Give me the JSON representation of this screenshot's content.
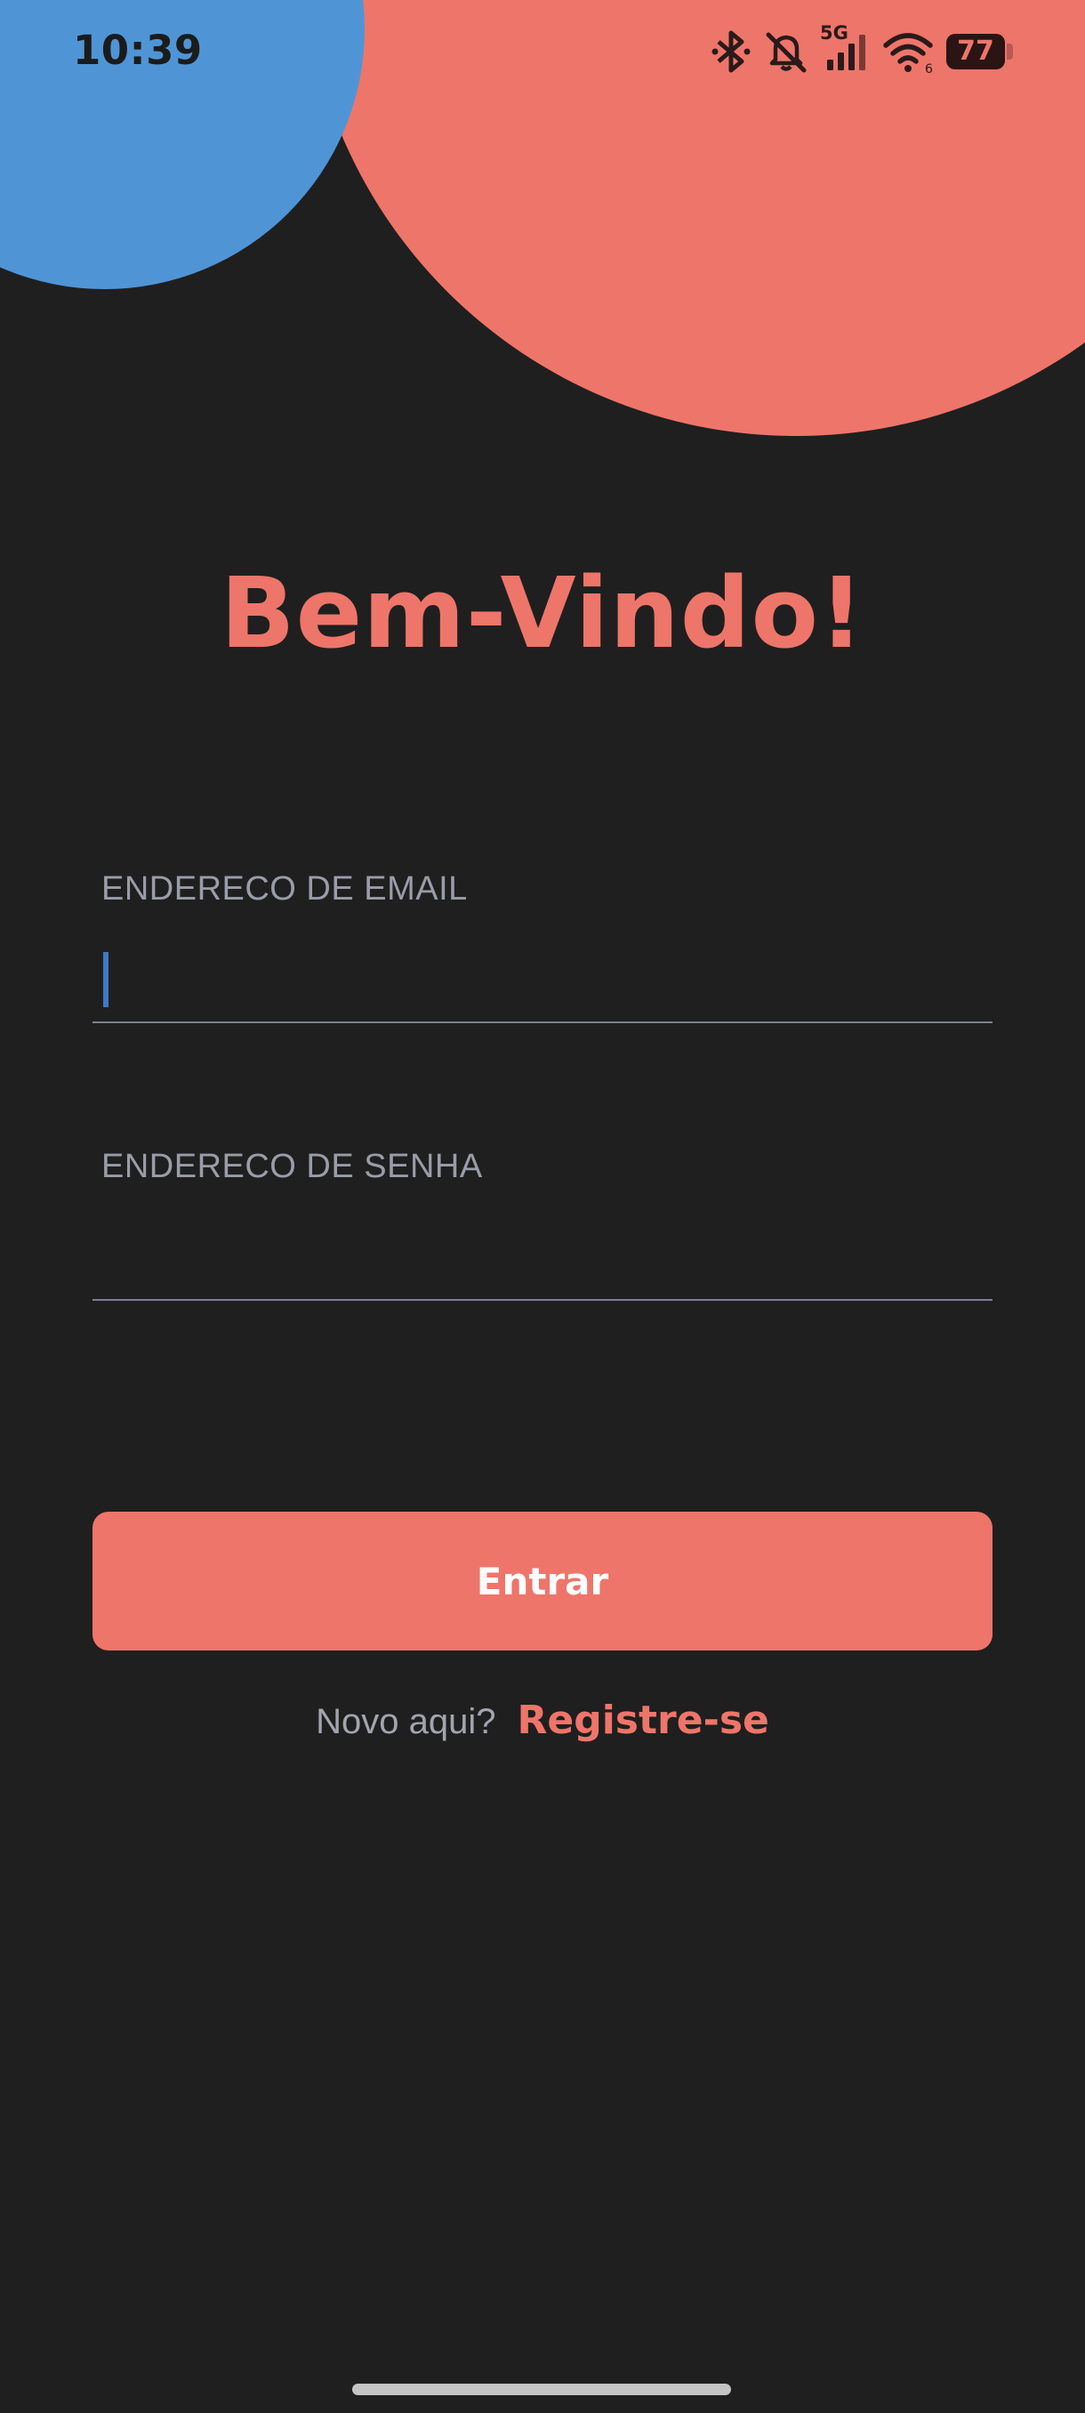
{
  "status_bar": {
    "time": "10:39",
    "network_label": "5G",
    "battery_level": "77",
    "icons": [
      "bluetooth-icon",
      "mute-bell-icon",
      "cellular-signal-icon",
      "wifi-icon",
      "battery-icon"
    ]
  },
  "colors": {
    "background": "#1f1f1f",
    "accent": "#ee756a",
    "blue_circle": "#4f95d6",
    "label_text": "#9a9ca8",
    "button_text": "#ffffff"
  },
  "login": {
    "title": "Bem-Vindo!",
    "email_label": "ENDERECO DE EMAIL",
    "email_value": "",
    "password_label": "ENDERECO DE SENHA",
    "password_value": "",
    "submit_label": "Entrar",
    "register_prompt": "Novo aqui?",
    "register_link": "Registre-se"
  }
}
